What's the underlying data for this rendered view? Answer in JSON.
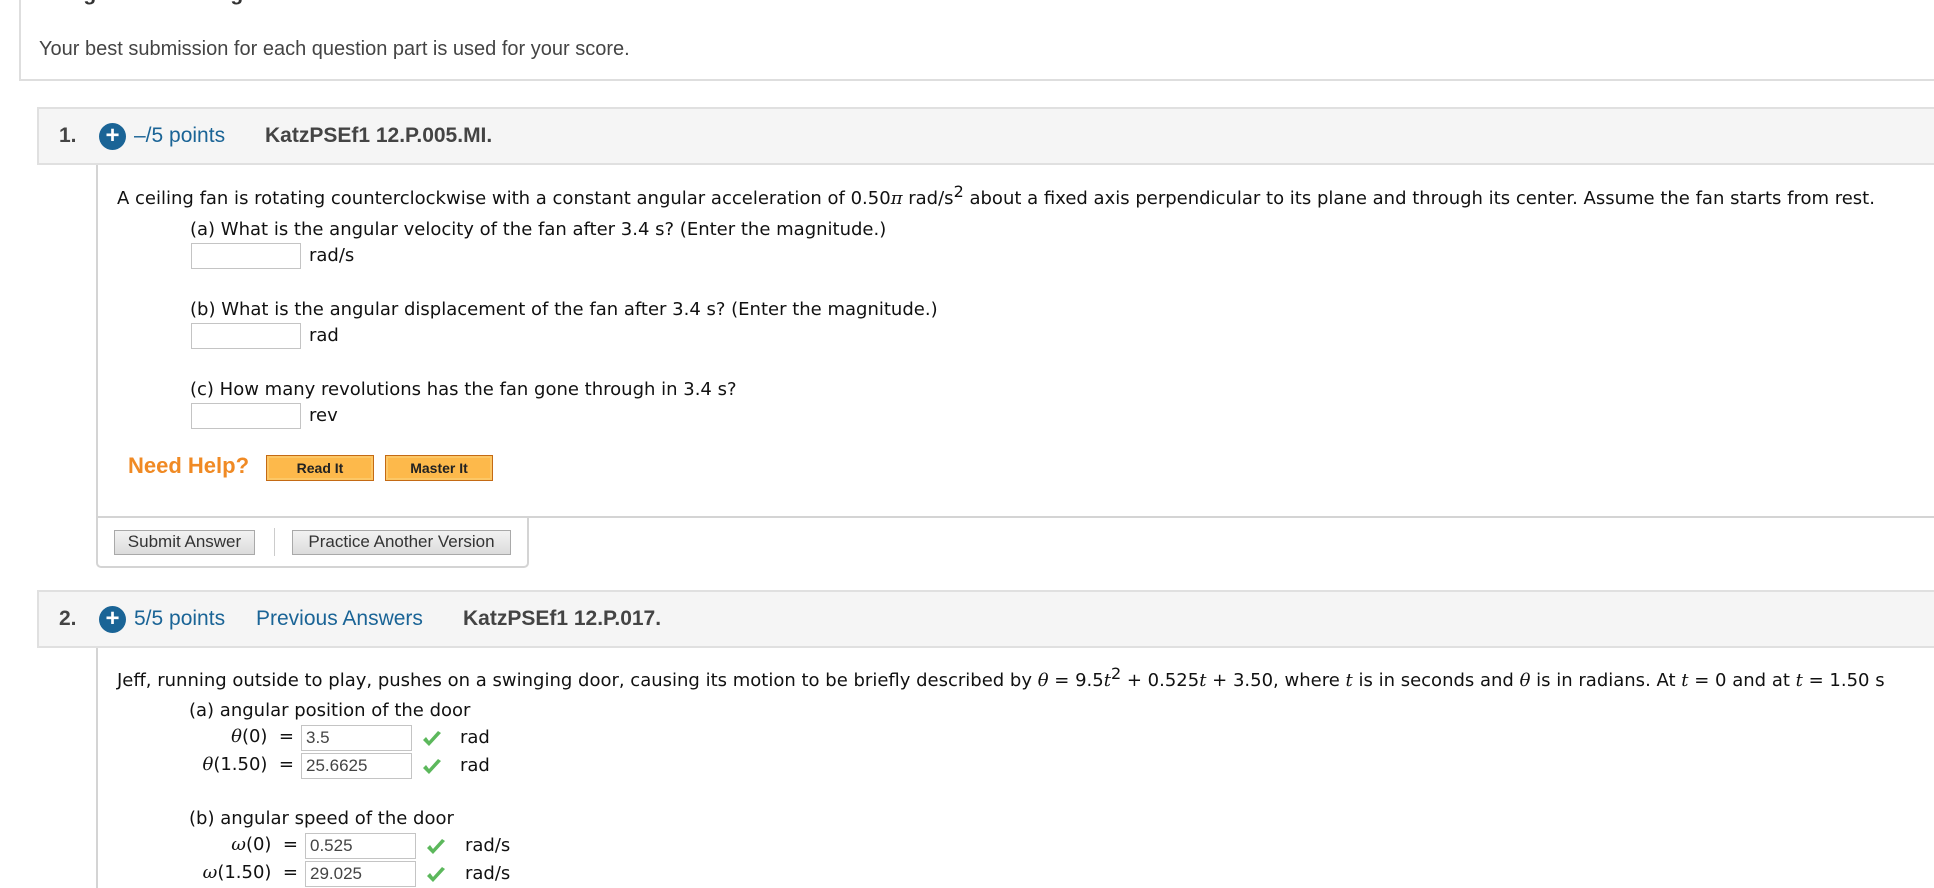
{
  "scoring": {
    "title": "Assignment Scoring",
    "note": "Your best submission for each question part is used for your score."
  },
  "questions": [
    {
      "number": "1.",
      "points": "–/5 points",
      "code": "KatzPSEf1 12.P.005.MI.",
      "stem": {
        "before": "A ceiling fan is rotating counterclockwise with a constant angular acceleration of 0.50",
        "pi": "π",
        "unit": " rad/s",
        "sup": "2",
        "after": " about a fixed axis perpendicular to its plane and through its center. Assume the fan starts from rest."
      },
      "parts": [
        {
          "label": "(a) What is the angular velocity of the fan after 3.4 s? (Enter the magnitude.)",
          "value": "",
          "unit": "rad/s"
        },
        {
          "label": "(b) What is the angular displacement of the fan after 3.4 s? (Enter the magnitude.)",
          "value": "",
          "unit": "rad"
        },
        {
          "label": "(c) How many revolutions has the fan gone through in 3.4 s?",
          "value": "",
          "unit": "rev"
        }
      ],
      "help": {
        "label": "Need Help?",
        "read_it": "Read It",
        "master_it": "Master It"
      },
      "actions": {
        "submit": "Submit Answer",
        "practice": "Practice Another Version"
      }
    },
    {
      "number": "2.",
      "points": "5/5 points",
      "previous_answers": "Previous Answers",
      "code": "KatzPSEf1 12.P.017.",
      "stem": {
        "part1": "Jeff, running outside to play, pushes on a swinging door, causing its motion to be briefly described by ",
        "theta": "θ",
        "eq1": " = 9.5",
        "t": "t",
        "sup": "2",
        "eq2": " + 0.525",
        "eq3": " + 3.50,  where ",
        "part2": " is in seconds and ",
        "part3": " is in radians. At ",
        "eq4": " = 0  and at ",
        "eq5": " = 1.50 s"
      },
      "part_a": {
        "label": "(a) angular position of the door",
        "rows": [
          {
            "symbol": "θ",
            "arg": "(0)",
            "eq": "=",
            "value": "3.5",
            "unit": "rad",
            "status": "correct"
          },
          {
            "symbol": "θ",
            "arg": "(1.50)",
            "eq": "=",
            "value": "25.6625",
            "unit": "rad",
            "status": "correct"
          }
        ]
      },
      "part_b": {
        "label": "(b) angular speed of the door",
        "rows": [
          {
            "symbol": "ω",
            "arg": "(0)",
            "eq": "=",
            "value": "0.525",
            "unit": "rad/s",
            "status": "correct"
          },
          {
            "symbol": "ω",
            "arg": "(1.50)",
            "eq": "=",
            "value": "29.025",
            "unit": "rad/s",
            "status": "correct"
          }
        ]
      }
    }
  ],
  "colors": {
    "link_blue": "#1a6496",
    "help_orange": "#f08a24",
    "button_orange": "#fdb94b",
    "check_green": "#5cb85c",
    "header_bg": "#f5f5f5"
  }
}
